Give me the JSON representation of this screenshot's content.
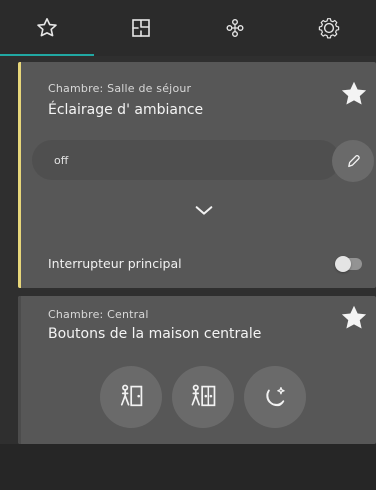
{
  "nav": {
    "tabs": [
      {
        "id": "favorites",
        "icon": "star-outline-icon",
        "active": true
      },
      {
        "id": "rooms",
        "icon": "floorplan-icon",
        "active": false
      },
      {
        "id": "network",
        "icon": "network-icon",
        "active": false
      },
      {
        "id": "settings",
        "icon": "gear-icon",
        "active": false
      }
    ],
    "accent_color": "#20b6b0"
  },
  "cards": [
    {
      "room_label": "Chambre: Salle de séjour",
      "title": "Éclairage d' ambiance",
      "favorite": true,
      "state_label": "off",
      "switch_label": "Interrupteur principal",
      "switch_on": false,
      "accent_color": "#e7d67a"
    },
    {
      "room_label": "Chambre: Central",
      "title": "Boutons de la maison centrale",
      "favorite": true,
      "buttons": [
        {
          "icon": "person-door-icon"
        },
        {
          "icon": "person-double-door-icon"
        },
        {
          "icon": "moon-star-icon"
        }
      ]
    }
  ]
}
